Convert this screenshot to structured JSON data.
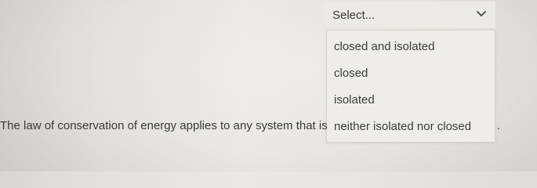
{
  "question": {
    "sentence": "The law of conservation of energy applies to any system that is",
    "trailing_punctuation": "."
  },
  "select": {
    "placeholder": "Select...",
    "icon": "chevron-down-icon",
    "options": [
      "closed and isolated",
      "closed",
      "isolated",
      "neither isolated nor closed"
    ]
  }
}
